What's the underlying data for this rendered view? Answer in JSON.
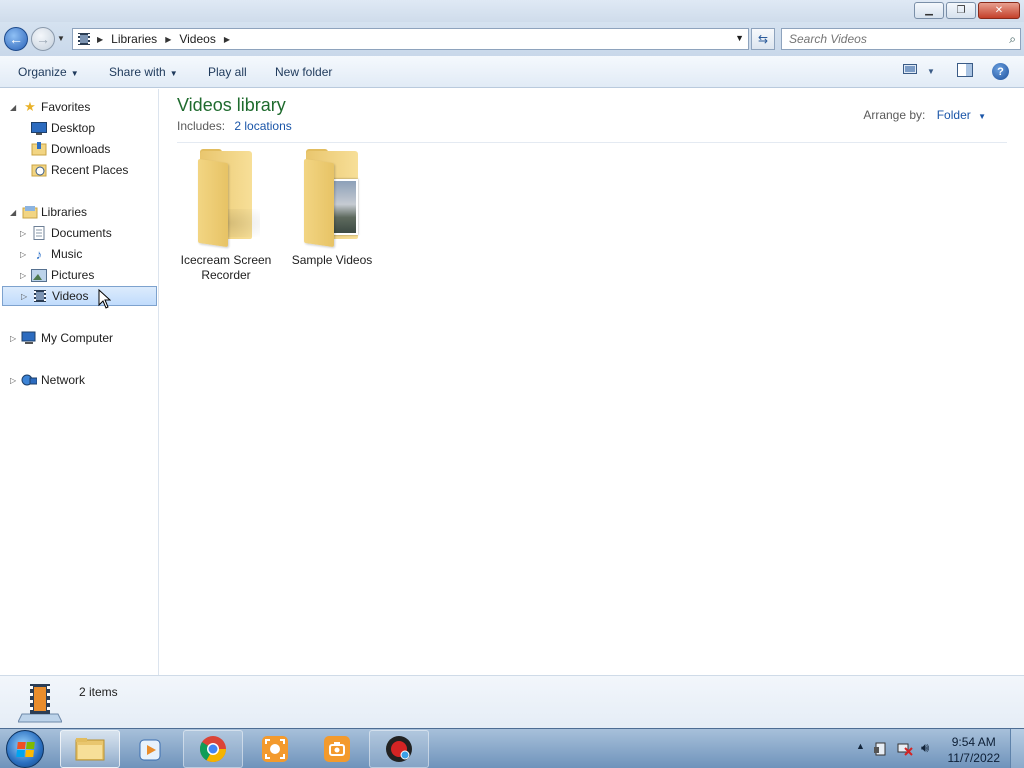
{
  "window": {
    "minimize_glyph": "▁",
    "maximize_glyph": "❐",
    "close_glyph": "✕"
  },
  "address": {
    "segments": [
      "Libraries",
      "Videos"
    ],
    "search_placeholder": "Search Videos"
  },
  "toolbar": {
    "organize": "Organize",
    "share_with": "Share with",
    "play_all": "Play all",
    "new_folder": "New folder",
    "help": "?"
  },
  "nav": {
    "favorites": "Favorites",
    "desktop": "Desktop",
    "downloads": "Downloads",
    "recent_places": "Recent Places",
    "libraries": "Libraries",
    "documents": "Documents",
    "music": "Music",
    "pictures": "Pictures",
    "videos": "Videos",
    "my_computer": "My Computer",
    "network": "Network"
  },
  "library": {
    "title": "Videos library",
    "includes_label": "Includes:",
    "includes_link": "2 locations",
    "arrange_label": "Arrange by:",
    "arrange_value": "Folder"
  },
  "folders": [
    {
      "line1": "Icecream Screen",
      "line2": "Recorder"
    },
    {
      "line1": "Sample Videos",
      "line2": ""
    }
  ],
  "details": {
    "item_count": "2 items"
  },
  "taskbar": {
    "apps": [
      "Windows Explorer",
      "Windows Media Player",
      "Google Chrome",
      "Icecream Screen Recorder",
      "Screenshot tool",
      "Screen recorder"
    ]
  },
  "clock": {
    "time": "9:54 AM",
    "date": "11/7/2022"
  },
  "colors": {
    "accent_blue": "#1a55a8",
    "library_title": "#1f6b2e",
    "selection": "#c1dcfc"
  }
}
